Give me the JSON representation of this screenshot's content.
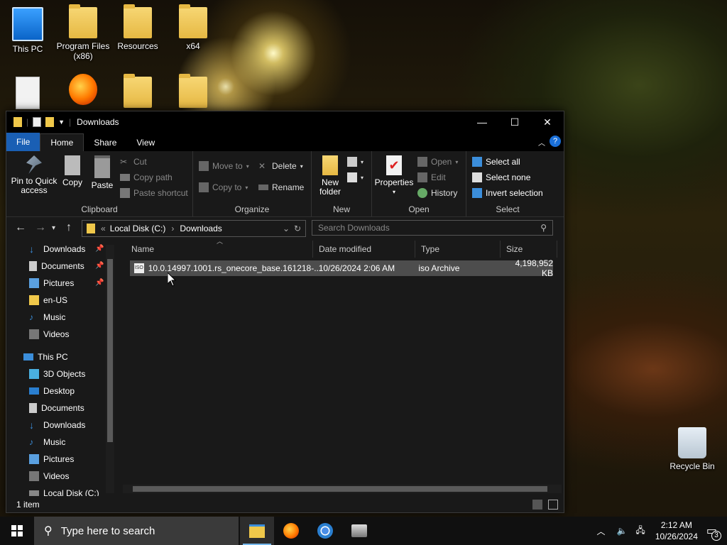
{
  "desktop": {
    "icons": [
      {
        "label": "This PC",
        "icon": "computer-icon"
      },
      {
        "label": "Program Files (x86)",
        "icon": "folder-icon"
      },
      {
        "label": "Resources",
        "icon": "folder-icon"
      },
      {
        "label": "x64",
        "icon": "folder-icon"
      },
      {
        "label": "",
        "icon": "document-shortcut-icon"
      },
      {
        "label": "",
        "icon": "firefox-installer-icon"
      },
      {
        "label": "",
        "icon": "folder-icon"
      },
      {
        "label": "",
        "icon": "folder-icon"
      },
      {
        "label": "Recycle Bin",
        "icon": "recycle-bin-icon"
      }
    ]
  },
  "window": {
    "title": "Downloads",
    "controls": {
      "minimize": "—",
      "maximize": "☐",
      "close": "✕"
    },
    "tabs": [
      "File",
      "Home",
      "Share",
      "View"
    ],
    "help": "?",
    "ribbon": {
      "clipboard": {
        "label": "Clipboard",
        "pin": "Pin to Quick access",
        "copy": "Copy",
        "paste": "Paste",
        "cut": "Cut",
        "copy_path": "Copy path",
        "paste_shortcut": "Paste shortcut"
      },
      "organize": {
        "label": "Organize",
        "move_to": "Move to",
        "copy_to": "Copy to",
        "delete": "Delete",
        "rename": "Rename"
      },
      "new": {
        "label": "New",
        "new_folder": "New folder"
      },
      "open": {
        "label": "Open",
        "properties": "Properties",
        "open": "Open",
        "edit": "Edit",
        "history": "History"
      },
      "select": {
        "label": "Select",
        "select_all": "Select all",
        "select_none": "Select none",
        "invert": "Invert selection"
      }
    },
    "address": {
      "crumb_prefix": "«",
      "crumb1": "Local Disk (C:)",
      "crumb2": "Downloads"
    },
    "search_placeholder": "Search Downloads",
    "nav": {
      "quick": [
        {
          "label": "Downloads",
          "pinned": true
        },
        {
          "label": "Documents",
          "pinned": true
        },
        {
          "label": "Pictures",
          "pinned": true
        },
        {
          "label": "en-US",
          "pinned": false
        },
        {
          "label": "Music",
          "pinned": false
        },
        {
          "label": "Videos",
          "pinned": false
        }
      ],
      "this_pc": "This PC",
      "pc_items": [
        "3D Objects",
        "Desktop",
        "Documents",
        "Downloads",
        "Music",
        "Pictures",
        "Videos",
        "Local Disk (C:)"
      ]
    },
    "columns": [
      "Name",
      "Date modified",
      "Type",
      "Size"
    ],
    "files": [
      {
        "name": "10.0.14997.1001.rs_onecore_base.161218-...",
        "date": "10/26/2024 2:06 AM",
        "type": "iso Archive",
        "size": "4,198,952 KB"
      }
    ],
    "status": "1 item"
  },
  "taskbar": {
    "search_placeholder": "Type here to search",
    "time": "2:12 AM",
    "date": "10/26/2024",
    "notifications": "3"
  }
}
